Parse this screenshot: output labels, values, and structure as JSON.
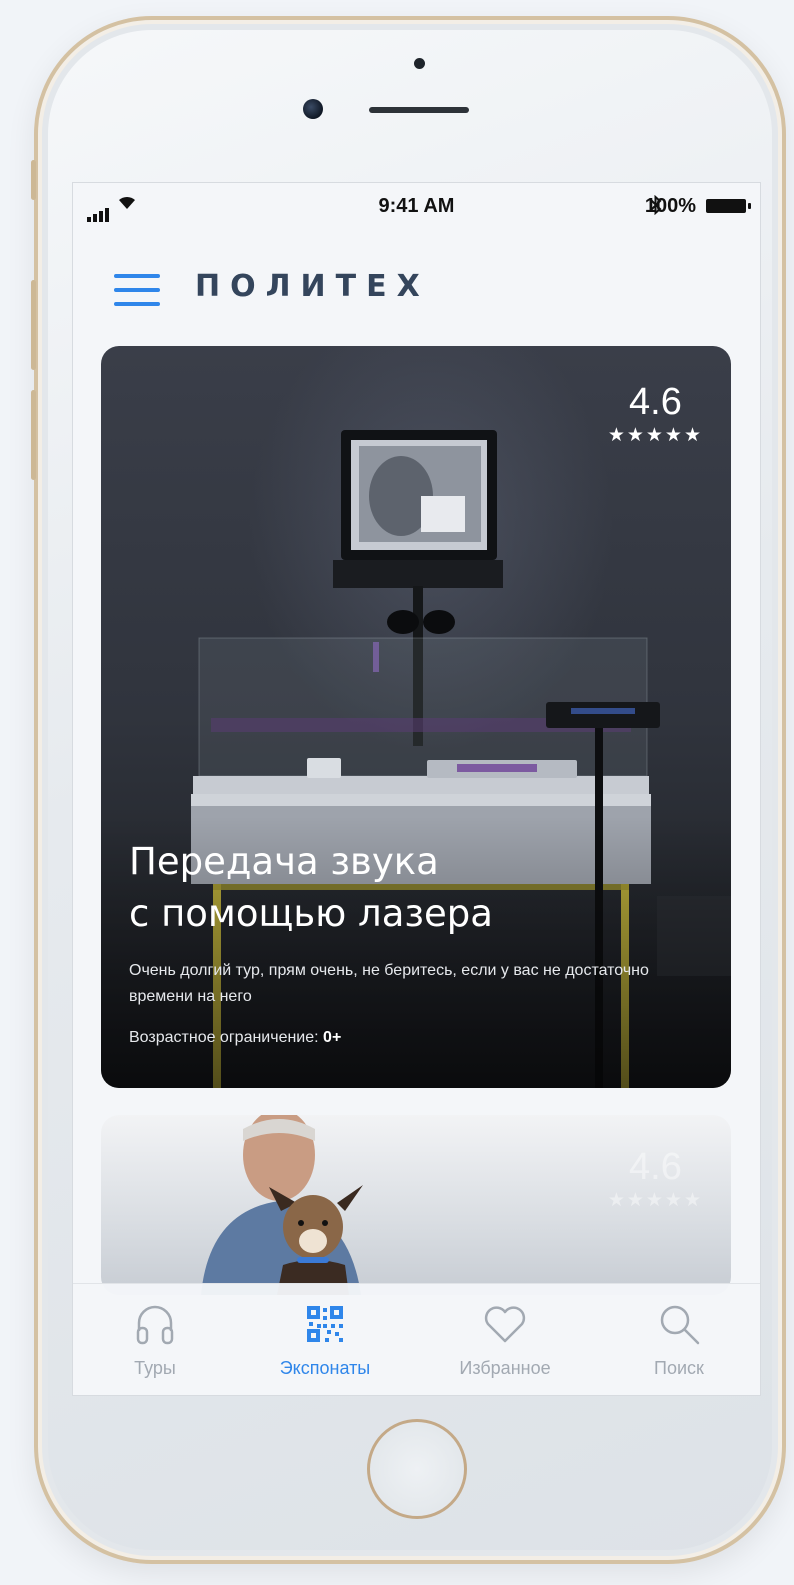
{
  "status_bar": {
    "time": "9:41 AM",
    "battery": "100%",
    "bluetooth_icon": "bluetooth-icon",
    "signal_icon": "cellular-signal-icon",
    "wifi_icon": "wifi-icon"
  },
  "header": {
    "menu_icon": "hamburger-menu-icon",
    "logo": "ПОЛИТЕХ"
  },
  "cards": [
    {
      "rating": "4.6",
      "stars": "★★★★★",
      "title_line1": "Передача звука",
      "title_line2": "с помощью лазера",
      "description": "Очень долгий тур, прям очень, не беритесь, если у вас не достаточно времени на него",
      "age_label": "Возрастное ограничение:",
      "age_value": "0+"
    },
    {
      "rating": "4.6",
      "stars": "★★★★★"
    }
  ],
  "tabbar": {
    "items": [
      {
        "label": "Туры",
        "icon": "headphones-icon"
      },
      {
        "label": "Экспонаты",
        "icon": "qr-code-icon",
        "active": true
      },
      {
        "label": "Избранное",
        "icon": "heart-icon"
      },
      {
        "label": "Поиск",
        "icon": "search-icon"
      }
    ]
  },
  "colors": {
    "accent": "#2f86ea",
    "logo": "#34455c",
    "tab_inactive": "#a2a9b2"
  }
}
